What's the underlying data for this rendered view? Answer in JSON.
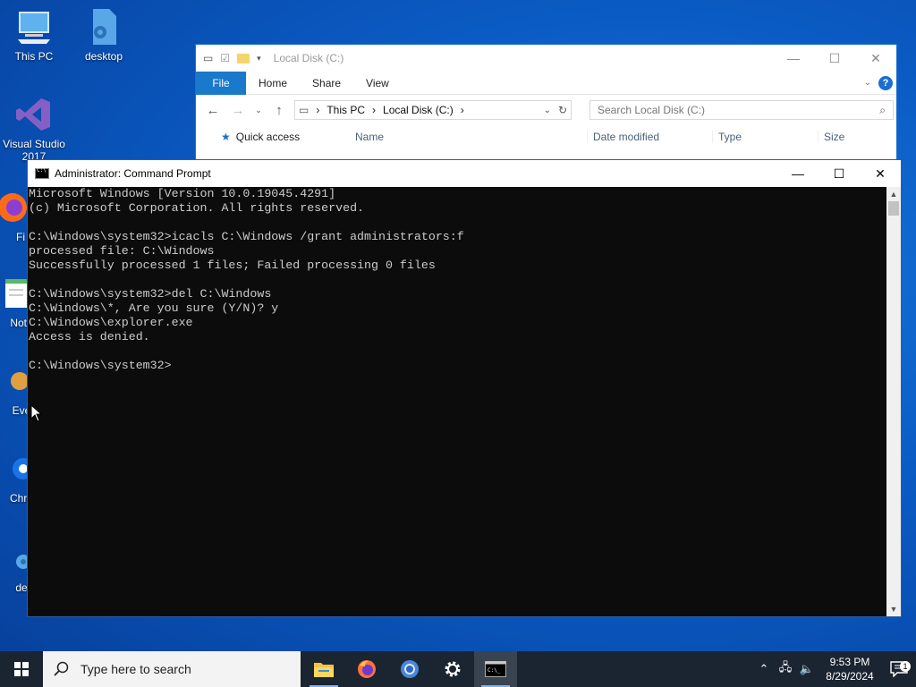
{
  "desktop": {
    "icons": [
      {
        "label": "This PC"
      },
      {
        "label": "desktop"
      },
      {
        "label": "Visual Studio 2017"
      },
      {
        "label": "Fi"
      },
      {
        "label": "Note"
      },
      {
        "label": "Eve"
      },
      {
        "label": "Chro"
      },
      {
        "label": "de"
      }
    ]
  },
  "explorer": {
    "title": "Local Disk (C:)",
    "tabs": {
      "file": "File",
      "home": "Home",
      "share": "Share",
      "view": "View"
    },
    "breadcrumb": [
      "This PC",
      "Local Disk (C:)"
    ],
    "search_placeholder": "Search Local Disk (C:)",
    "nav": {
      "quick_access": "Quick access"
    },
    "columns": {
      "name": "Name",
      "date": "Date modified",
      "type": "Type",
      "size": "Size"
    }
  },
  "cmd": {
    "title": "Administrator: Command Prompt",
    "lines": [
      "Microsoft Windows [Version 10.0.19045.4291]",
      "(c) Microsoft Corporation. All rights reserved.",
      "",
      "C:\\Windows\\system32>icacls C:\\Windows /grant administrators:f",
      "processed file: C:\\Windows",
      "Successfully processed 1 files; Failed processing 0 files",
      "",
      "C:\\Windows\\system32>del C:\\Windows",
      "C:\\Windows\\*, Are you sure (Y/N)? y",
      "C:\\Windows\\explorer.exe",
      "Access is denied.",
      "",
      "C:\\Windows\\system32>"
    ]
  },
  "taskbar": {
    "search_placeholder": "Type here to search",
    "apps": [
      "file-explorer",
      "firefox",
      "chrome",
      "settings",
      "command-prompt"
    ],
    "clock": {
      "time": "9:53 PM",
      "date": "8/29/2024"
    },
    "notification_count": "1"
  },
  "colors": {
    "accent": "#1979ca",
    "cmd_bg": "#0c0c0c",
    "cmd_fg": "#cccccc",
    "taskbar": "#1b2431"
  }
}
